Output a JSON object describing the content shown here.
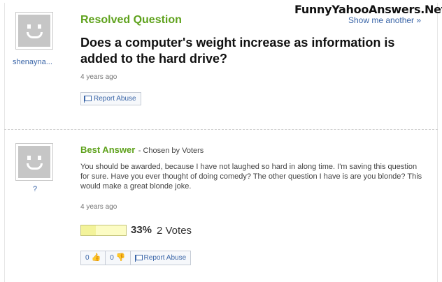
{
  "watermark": "FunnyYahooAnswers.Net",
  "show_another": "Show me another »",
  "question": {
    "status": "Resolved Question",
    "user": "shenayna...",
    "text": "Does a computer's weight increase as information is added to the hard drive?",
    "time": "4 years ago",
    "report": "Report Abuse"
  },
  "answer": {
    "user": "?",
    "title": "Best Answer",
    "chosen": "- Chosen by Voters",
    "text": "You should be awarded, because I have not laughed so hard in along time. I'm saving this question for sure. Have you ever thought of doing comedy? The other question I have is are you blonde? This would make a great blonde joke.",
    "time": "4 years ago",
    "vote_percent": "33%",
    "vote_fraction": 0.33,
    "votes": "2 Votes",
    "thumbs_up": "0",
    "thumbs_down": "0",
    "report": "Report Abuse"
  },
  "icons": {
    "avatar": "default-avatar-icon",
    "report": "flag-icon",
    "thumbs_up": "thumbs-up-icon",
    "thumbs_down": "thumbs-down-icon"
  },
  "colors": {
    "green": "#5fa21d",
    "link": "#3b66a8"
  }
}
